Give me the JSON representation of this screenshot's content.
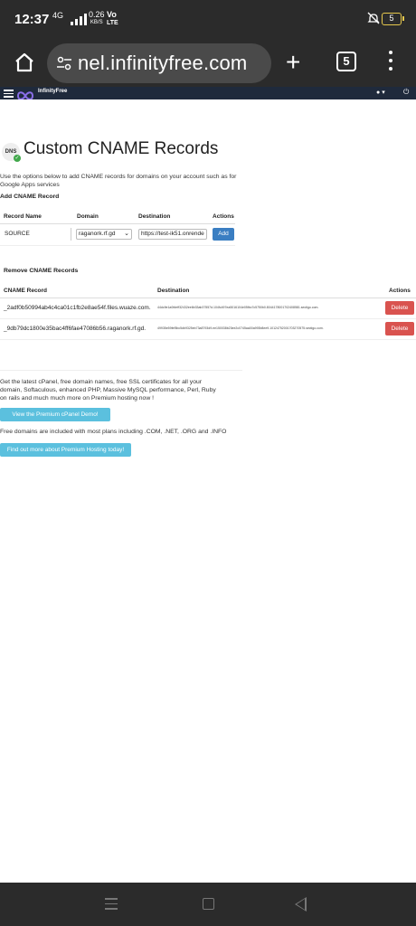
{
  "status_bar": {
    "time": "12:37",
    "network": "4G",
    "speed_value": "0.26",
    "speed_unit": "KB/S",
    "volte_top": "Vo",
    "volte_bottom": "LTE",
    "battery": "5"
  },
  "browser": {
    "url": "nel.infinityfree.com",
    "tab_count": "5"
  },
  "site_header": {
    "brand": "InfinityFree",
    "user_caret": "▾"
  },
  "page": {
    "title": "Custom CNAME Records",
    "intro": "Use the options below to add CNAME records for domains on your account such as for Google Apps services",
    "add_heading": "Add CNAME Record",
    "add_table": {
      "headers": [
        "Record Name",
        "Domain",
        "Destination",
        "Actions"
      ],
      "record_name": "SOURCE",
      "domain_selected": "raganork.rf.gd",
      "destination_value": "https://test-ik51.onrende",
      "add_label": "Add"
    },
    "remove_heading": "Remove CNAME Records",
    "remove_table": {
      "headers": [
        "CNAME Record",
        "Destination",
        "Actions"
      ],
      "rows": [
        {
          "name": "_2adf0b50994ab4c4ca01c1fb2e8ae54f.files.wuaze.com.",
          "destination": "44dc9e1a0fdeff32432ee6b33ab37557d.104fc497ea5016104e05fbc7c5750b0.8044178001702408581.sectigo.com.",
          "delete_label": "Delete"
        },
        {
          "name": "_9db79dc1800e35bac4ff6fae47086b56.raganork.rf.gd.",
          "destination": "49935e59fef5bc5db9325eb73a8793d9.ee150038b23ee2c0745aa00a993b8ee9.1012475200170327057​5.sectigo.com.",
          "delete_label": "Delete"
        }
      ]
    },
    "promo_text": "Get the latest cPanel, free domain names, free SSL certificates for all your domain, Softaculous, enhanced PHP, Massive MySQL performance, Perl, Ruby on rails and much much more on Premium hosting now !",
    "demo_button": "View the Premium cPanel Demo!",
    "domains_text": "Free domains are included with most plans including .COM, .NET, .ORG and .INFO",
    "premium_button": "Find out more about Premium Hosting today!"
  }
}
